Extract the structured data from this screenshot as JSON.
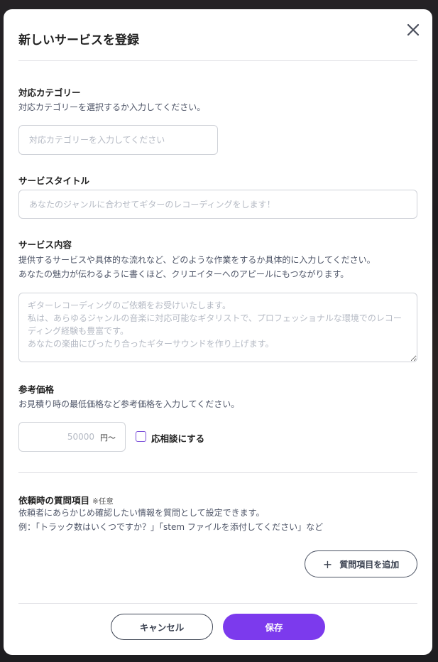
{
  "modal": {
    "title": "新しいサービスを登録"
  },
  "category": {
    "label": "対応カテゴリー",
    "help": "対応カテゴリーを選択するか入力してください。",
    "placeholder": "対応カテゴリーを入力してください",
    "value": ""
  },
  "service_title": {
    "label": "サービスタイトル",
    "placeholder": "あなたのジャンルに合わせてギターのレコーディングをします！",
    "value": ""
  },
  "service_content": {
    "label": "サービス内容",
    "help_line1": "提供するサービスや具体的な流れなど、どのような作業をするか具体的に入力してください。",
    "help_line2": "あなたの魅力が伝わるように書くほど、クリエイターへのアピールにもつながります。",
    "placeholder": "ギターレコーディングのご依頼をお受けいたします。\n私は、あらゆるジャンルの音楽に対応可能なギタリストで、プロフェッショナルな環境でのレコーディング経験も豊富です。\nあなたの楽曲にぴったり合ったギターサウンドを作り上げます。",
    "value": ""
  },
  "price": {
    "label": "参考価格",
    "help": "お見積り時の最低価格など参考価格を入力してください。",
    "placeholder": "50000",
    "value": "",
    "unit": "円〜",
    "negotiable_label": "応相談にする",
    "negotiable_checked": false
  },
  "questions": {
    "label": "依頼時の質問項目",
    "optional_tag": "※任意",
    "help_line1": "依頼者にあらかじめ確認したい情報を質問として設定できます。",
    "help_line2": "例：「トラック数はいくつですか？」「stem ファイルを添付してください」など",
    "add_label": "質問項目を追加",
    "add_icon": "+"
  },
  "footer": {
    "cancel_label": "キャンセル",
    "save_label": "保存"
  },
  "colors": {
    "accent": "#7c3aed",
    "checkbox_border": "#7b4fd9"
  },
  "icons": {
    "close": "close-icon",
    "add": "plus-icon"
  }
}
